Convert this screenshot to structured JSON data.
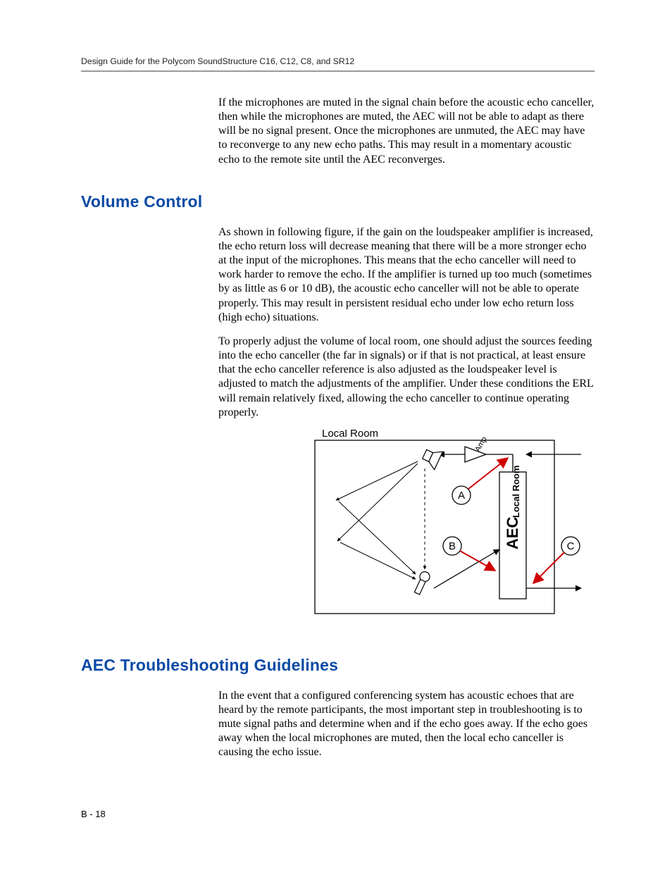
{
  "header": {
    "running_title": "Design Guide for the Polycom SoundStructure C16, C12, C8, and SR12"
  },
  "intro_paragraph": "If the microphones are muted in the signal chain before the acoustic echo canceller, then while the microphones are muted, the AEC will not be able to adapt as there will be no signal present. Once the microphones are unmuted, the AEC may have to reconverge to any new echo paths. This may result in a momentary acoustic echo to the remote site until the AEC reconverges.",
  "sections": {
    "volume_control": {
      "heading": "Volume Control",
      "p1": "As shown in following figure, if the gain on the loudspeaker amplifier is increased, the echo return loss will decrease meaning that there will be a more stronger echo at the input of the microphones. This means that the echo canceller will need to work harder to remove the echo. If the amplifier is turned up too much (sometimes by as little as 6 or 10 dB), the acoustic echo canceller will not be able to operate properly. This may result in persistent residual echo under low echo return loss (high echo) situations.",
      "p2": "To properly adjust the volume of local room, one should adjust the sources feeding into the echo canceller (the far in signals) or if that is not practical, at least ensure that the echo canceller reference is also adjusted as the loudspeaker level is adjusted to match the adjustments of the amplifier. Under these conditions the ERL will remain relatively fixed, allowing the echo canceller to continue operating properly."
    },
    "aec_trouble": {
      "heading": "AEC Troubleshooting Guidelines",
      "p1": "In the event that a configured conferencing system has acoustic echoes that are heard by the remote participants, the most important step in troubleshooting is to mute signal paths and determine when and if the echo goes away.  If the echo goes away when the local microphones are muted, then the local echo canceller is causing the echo issue."
    }
  },
  "figure": {
    "room_label": "Local Room",
    "amp_label": "Amp",
    "aec_main": "AEC",
    "aec_sub": "Local Room",
    "callouts": {
      "a": "A",
      "b": "B",
      "c": "C"
    }
  },
  "footer": {
    "page_number": "B - 18"
  }
}
